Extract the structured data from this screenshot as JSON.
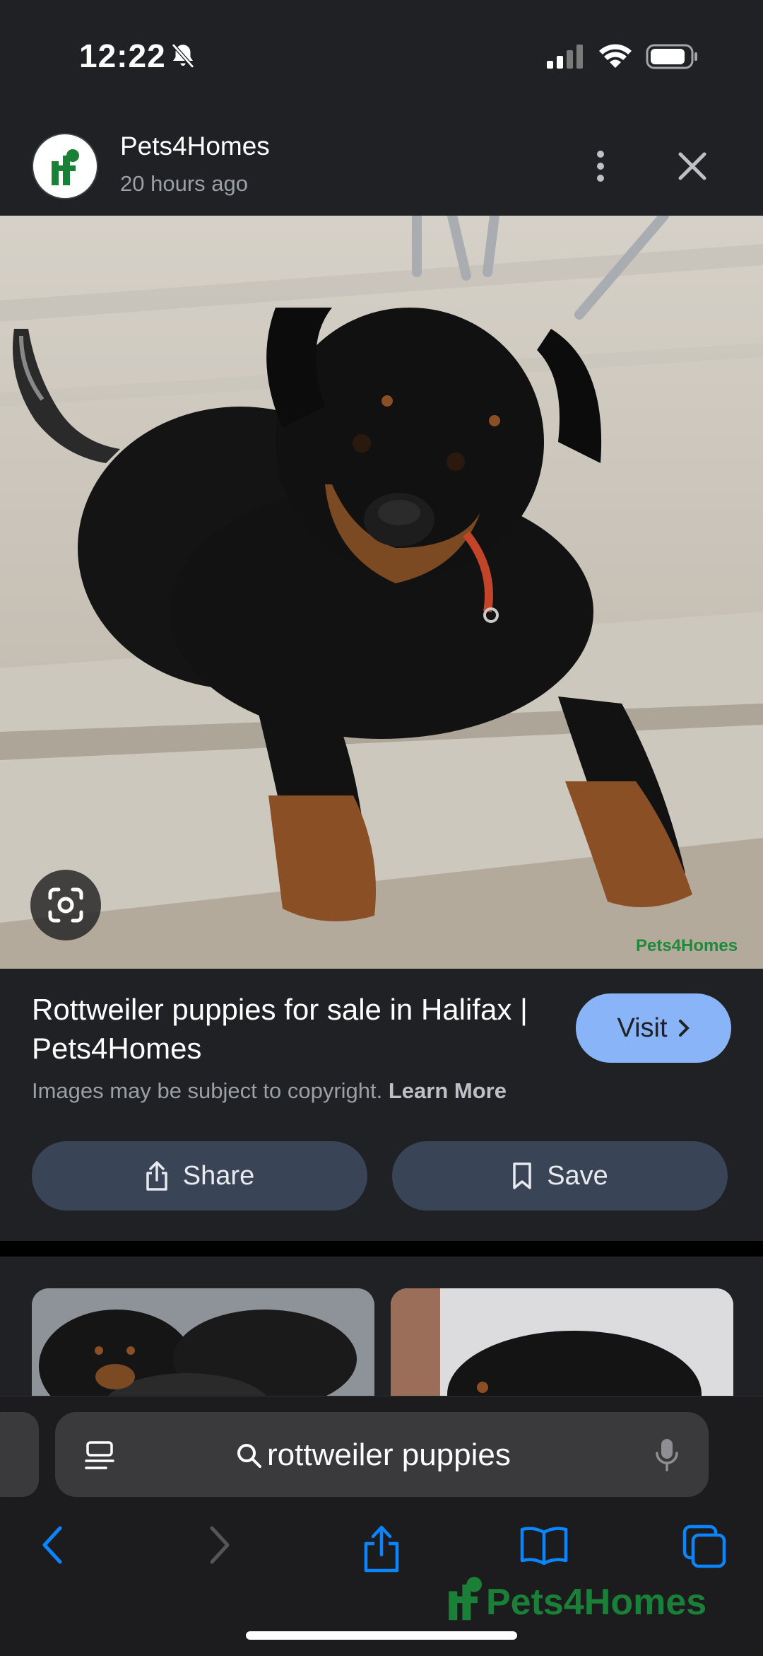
{
  "status_bar": {
    "time": "12:22"
  },
  "header": {
    "site_name": "Pets4Homes",
    "time_ago": "20 hours ago"
  },
  "image": {
    "alt": "Rottweiler puppy lying on a concrete step",
    "watermark": "Pets4Homes"
  },
  "result": {
    "title": "Rottweiler puppies for sale in Halifax | Pets4Homes",
    "visit_label": "Visit",
    "copyright_text": "Images may be subject to copyright.",
    "learn_more": "Learn More",
    "share_label": "Share",
    "save_label": "Save"
  },
  "browser": {
    "search_text": "rottweiler puppies",
    "footer_brand": "Pets4Homes"
  },
  "colors": {
    "background": "#202124",
    "visit_button": "#8ab4f8",
    "action_button": "#394457",
    "ios_blue": "#0a84ff",
    "brand_green": "#1a7f37"
  }
}
